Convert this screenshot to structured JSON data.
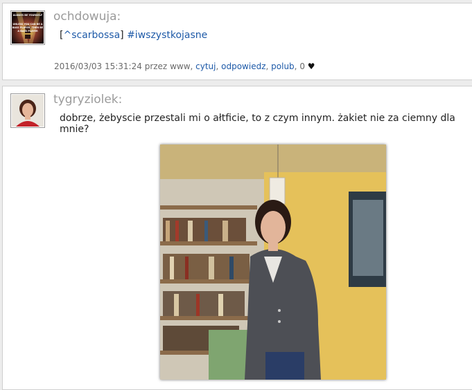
{
  "posts": [
    {
      "username": "ochdowuja:",
      "content": {
        "bracket_open": "[",
        "mention": "^scarbossa",
        "bracket_close": "]",
        "hashtag": "#iwszystkojasne"
      },
      "meta": {
        "datetime": "2016/03/03 15:31:24",
        "by_text": "przez",
        "author": "www",
        "actions": [
          "cytuj",
          "odpowiedz",
          "polub"
        ],
        "likes": "0",
        "heart": "♥"
      },
      "avatar_text": [
        "ALWAYS BE YOURSELF",
        "UNLESS YOU CAN BE A",
        "BASS PLAYER, THEN BE",
        "A BASS PLAYER"
      ]
    },
    {
      "username": "tygryziolek:",
      "content": {
        "text": "dobrze, żebyscie przestali mi o ałtficie, to z czym innym. żakiet nie za ciemny dla mnie?"
      }
    }
  ],
  "colors": {
    "link": "#1e5aa8",
    "username": "#9b9b9b",
    "meta": "#6a6a6a"
  }
}
